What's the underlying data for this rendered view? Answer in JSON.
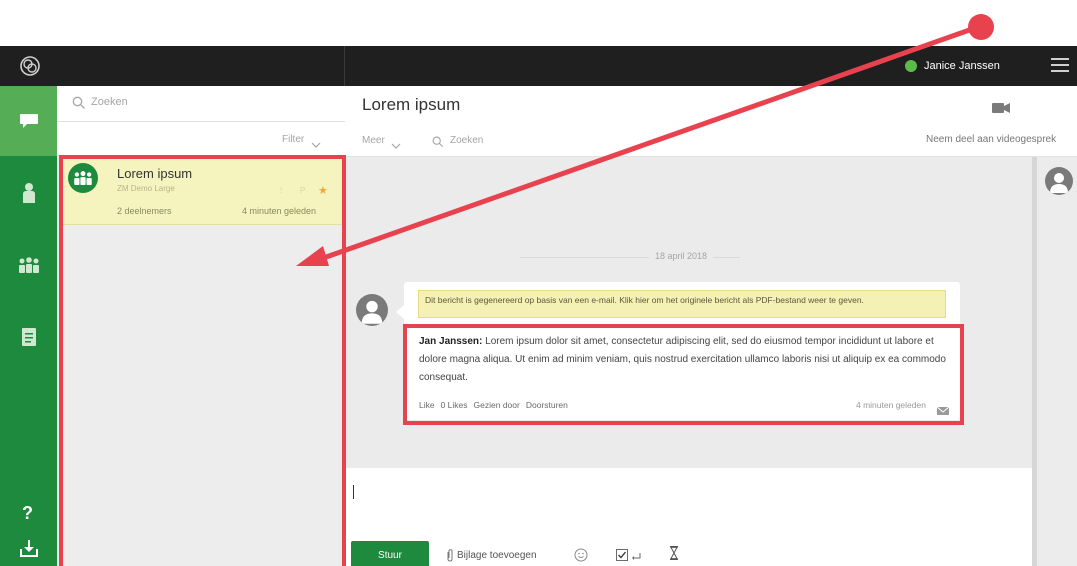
{
  "user": {
    "name": "Janice Janssen",
    "status_color": "#5dbb48"
  },
  "rail": {
    "items": [
      {
        "icon": "chat-icon",
        "active": true
      },
      {
        "icon": "person-icon",
        "active": false
      },
      {
        "icon": "group-icon",
        "active": false
      },
      {
        "icon": "document-icon",
        "active": false
      }
    ],
    "help": "?",
    "download_icon": "download-icon"
  },
  "list": {
    "search_placeholder": "Zoeken",
    "filter_label": "Filter",
    "conversations": [
      {
        "title": "Lorem ipsum",
        "subtitle": "ZM Demo Large",
        "participants": "2 deelnemers",
        "time": "4 minuten geleden",
        "meta1": "!",
        "meta2": "P",
        "starred": "★"
      }
    ]
  },
  "chat": {
    "title": "Lorem ipsum",
    "more_label": "Meer",
    "search_placeholder": "Zoeken",
    "video_join": "Neem deel aan videogesprek",
    "date": "18 april 2018",
    "message": {
      "notice": "Dit bericht is gegenereerd op basis van een e-mail. Klik hier om het originele bericht als PDF-bestand weer te geven.",
      "sender": "Jan Janssen:",
      "text": "Lorem ipsum dolor sit amet, consectetur adipiscing elit, sed do eiusmod tempor incididunt ut labore et dolore magna aliqua. Ut enim ad minim veniam, quis nostrud exercitation ullamco laboris nisi ut aliquip ex ea commodo consequat.",
      "actions": [
        "Like",
        "0 Likes",
        "Gezien door",
        "Doorsturen"
      ],
      "time": "4 minuten geleden"
    }
  },
  "composer": {
    "send_label": "Stuur",
    "attach_label": "Bijlage toevoegen"
  },
  "colors": {
    "brand_green": "#1e8a3e",
    "rail_active": "#55ad56",
    "highlight_yellow": "#f5f3be",
    "annotation_red": "#e8424f"
  }
}
